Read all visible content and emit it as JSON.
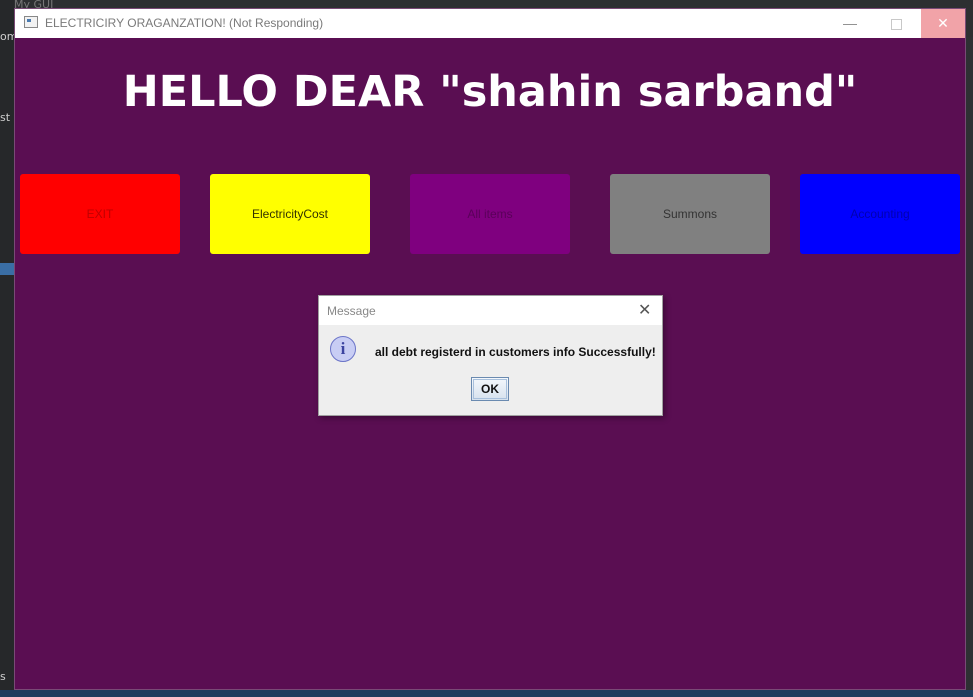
{
  "window": {
    "title": "ELECTRICIRY ORAGANZATION! (Not Responding)",
    "minimize_glyph": "—",
    "close_glyph": "✕"
  },
  "headline": "HELLO DEAR \"shahin sarband\"",
  "buttons": [
    {
      "label": "EXIT",
      "color": "#ff0000"
    },
    {
      "label": "ElectricityCost",
      "color": "#ffff00"
    },
    {
      "label": "All items",
      "color": "#7f007f"
    },
    {
      "label": "Summons",
      "color": "#808080"
    },
    {
      "label": "Accounting",
      "color": "#0000ff"
    }
  ],
  "dialog": {
    "title": "Message",
    "close_glyph": "✕",
    "icon": "info-icon",
    "icon_glyph": "i",
    "message": "all debt registerd in customers info Successfully!",
    "ok_label": "OK"
  },
  "background": {
    "top_text": "My GUI",
    "left_texts": [
      "om",
      "st",
      "s"
    ]
  },
  "colors": {
    "window_background": "#5a0e52"
  }
}
